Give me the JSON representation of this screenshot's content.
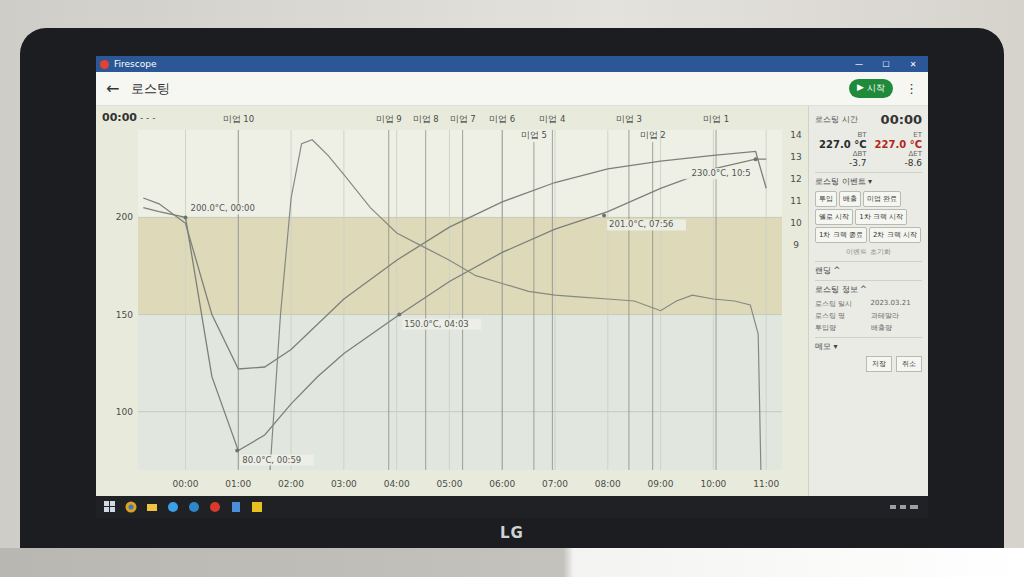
{
  "window": {
    "title": "Firescope",
    "controls": [
      "—",
      "☐",
      "✕"
    ]
  },
  "header": {
    "back": "←",
    "title": "로스팅",
    "start_button": {
      "icon": "▶",
      "label": "시작"
    },
    "menu": "⋮"
  },
  "chart": {
    "clock": "00:00",
    "status": "- - -",
    "x_ticks": [
      "00:00",
      "01:00",
      "02:00",
      "03:00",
      "04:00",
      "05:00",
      "06:00",
      "07:00",
      "08:00",
      "09:00",
      "10:00",
      "11:00"
    ],
    "y_ticks": [
      {
        "label": "100",
        "value": 100
      },
      {
        "label": "150",
        "value": 150
      },
      {
        "label": "200",
        "value": 200
      }
    ],
    "right_ticks": [
      "14",
      "13",
      "12",
      "11",
      "10",
      "9"
    ],
    "bands": [
      {
        "from": 150,
        "to": 200
      }
    ],
    "time_min": [
      -0.8,
      -0.5,
      0,
      0.5,
      1,
      1.5,
      2,
      2.5,
      3,
      4,
      5,
      6,
      7,
      8,
      9,
      10,
      10.8,
      11
    ],
    "series": [
      {
        "name": "ET",
        "values": [
          210,
          207,
          197,
          150,
          122,
          123,
          132,
          145,
          158,
          178,
          195,
          208,
          218,
          225,
          229,
          232,
          234,
          215
        ]
      },
      {
        "name": "BT",
        "values": [
          205,
          203,
          200,
          118,
          80,
          88,
          104,
          118,
          130,
          149,
          167,
          182,
          194,
          203,
          215,
          225,
          230,
          230
        ]
      }
    ],
    "ror": {
      "name": "RoR",
      "time_min": [
        1.6,
        1.8,
        2.0,
        2.2,
        2.4,
        2.7,
        3,
        3.5,
        4,
        4.5,
        5,
        5.5,
        6,
        6.5,
        7,
        7.5,
        8,
        8.5,
        9,
        9.3,
        9.6,
        10,
        10.4,
        10.7,
        10.85,
        10.9
      ],
      "values": [
        70,
        150,
        210,
        238,
        240,
        232,
        222,
        205,
        192,
        185,
        178,
        170,
        166,
        162,
        160,
        159,
        158,
        157,
        152,
        157,
        160,
        158,
        157,
        155,
        140,
        70
      ]
    },
    "events": [
      {
        "label": "미업 10",
        "time_min": 1.0
      },
      {
        "label": "미업 9",
        "time_min": 3.85
      },
      {
        "label": "미업 8",
        "time_min": 4.55
      },
      {
        "label": "미업 7",
        "time_min": 5.25
      },
      {
        "label": "미업 6",
        "time_min": 6.0
      },
      {
        "label": "미업 5",
        "time_min": 6.6
      },
      {
        "label": "미업 4",
        "time_min": 6.95
      },
      {
        "label": "미업 3",
        "time_min": 8.4
      },
      {
        "label": "미업 2",
        "time_min": 8.85
      },
      {
        "label": "미업 1",
        "time_min": 10.05
      }
    ],
    "annotations": [
      {
        "text": "200.0°C, 00:00",
        "series": "BT",
        "time_min": 0,
        "value": 200
      },
      {
        "text": "80.0°C, 00:59",
        "series": "BT",
        "time_min": 0.98,
        "value": 80
      },
      {
        "text": "150.0°C, 04:03",
        "series": "BT",
        "time_min": 4.05,
        "value": 150
      },
      {
        "text": "201.0°C, 07:56",
        "series": "BT",
        "time_min": 7.93,
        "value": 201
      },
      {
        "text": "230.0°C, 10:5",
        "series": "BT",
        "time_min": 10.8,
        "value": 230
      }
    ]
  },
  "panel": {
    "timer_label": "로스팅 시간",
    "timer": "00:00",
    "readings": [
      {
        "label": "BT",
        "value": "227.0 °C",
        "delta_label": "ΔBT",
        "delta": "-3.7",
        "color": "#2a2a2a"
      },
      {
        "label": "ET",
        "value": "227.0 °C",
        "delta_label": "ΔET",
        "delta": "-8.6",
        "color": "#b3261e"
      }
    ],
    "events_title": "로스팅 이벤트 ▾",
    "event_buttons": [
      "투입",
      "배출",
      "미업 완료",
      "옐로 시작",
      "1차 크랙 시작",
      "1차 크랙 종료",
      "2차 크랙 시작"
    ],
    "events_hint": "이벤트 초기화",
    "landing_title": "랜딩 ^",
    "info_title": "로스팅 정보 ^",
    "info": [
      {
        "label": "로스팅 일시",
        "value": "2023.03.21"
      },
      {
        "label": "로스팅 명",
        "value": "과테말라"
      },
      {
        "label": "투입량",
        "value": "배출량"
      }
    ],
    "memo_title": "메모 ▾",
    "memo_buttons": [
      "저장",
      "취소"
    ]
  },
  "laptop": {
    "brand": "LG"
  }
}
